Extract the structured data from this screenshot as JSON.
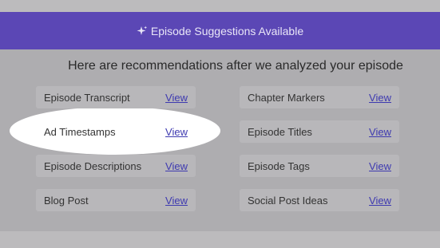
{
  "banner": {
    "icon": "sparkle-icon",
    "title": "Episode Suggestions Available"
  },
  "subtitle": "Here are recommendations after we analyzed your episode",
  "colors": {
    "banner": "#5b47b5",
    "link": "#3e3ab0",
    "spotlight": "#ffffff"
  },
  "suggestions": {
    "left": [
      {
        "label": "Episode Transcript",
        "action": "View"
      },
      {
        "label": "Ad Timestamps",
        "action": "View",
        "highlighted": true
      },
      {
        "label": "Episode Descriptions",
        "action": "View"
      },
      {
        "label": "Blog Post",
        "action": "View"
      }
    ],
    "right": [
      {
        "label": "Chapter Markers",
        "action": "View"
      },
      {
        "label": "Episode Titles",
        "action": "View"
      },
      {
        "label": "Episode Tags",
        "action": "View"
      },
      {
        "label": "Social Post Ideas",
        "action": "View"
      }
    ]
  }
}
